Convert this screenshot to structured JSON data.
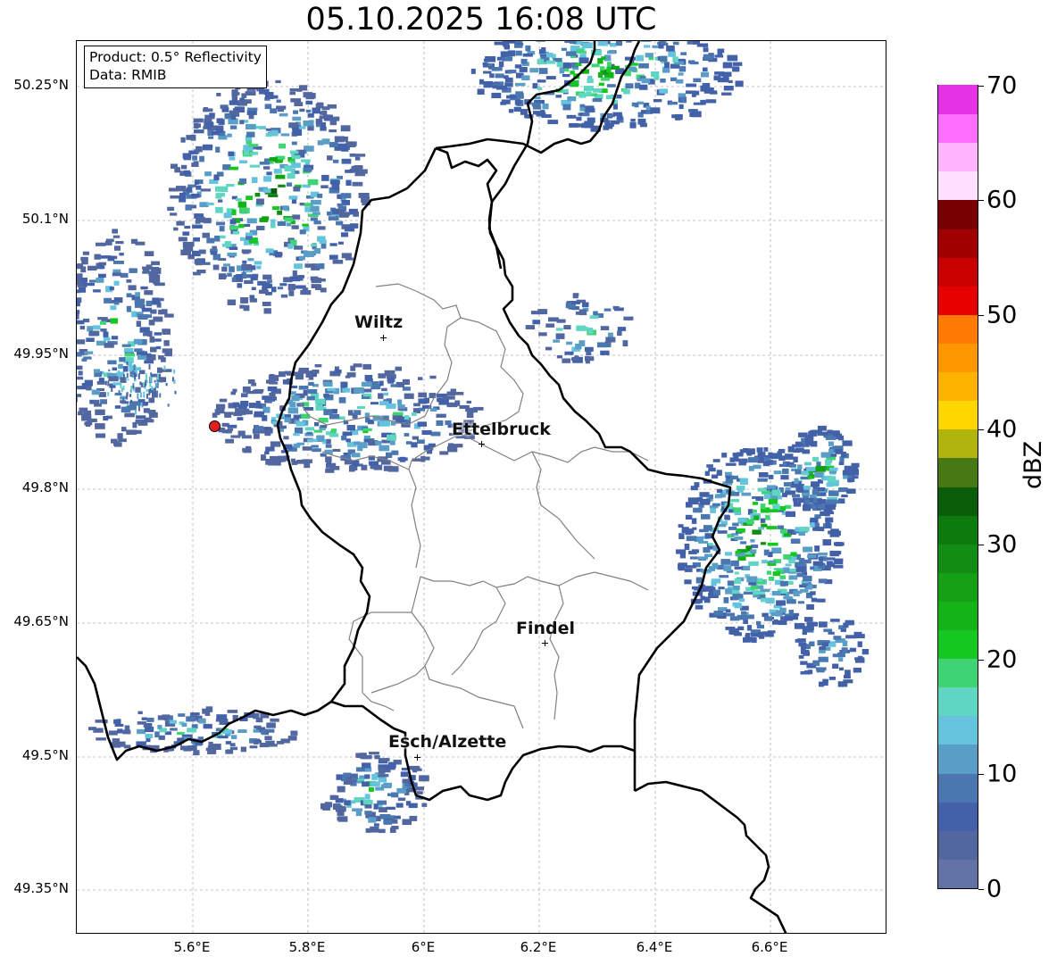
{
  "title": "05.10.2025 16:08 UTC",
  "info_box": {
    "product": "Product: 0.5° Reflectivity",
    "data": "Data: RMIB"
  },
  "axes": {
    "lat_labels": [
      "50.25°N",
      "50.1°N",
      "49.95°N",
      "49.8°N",
      "49.65°N",
      "49.5°N",
      "49.35°N"
    ],
    "lon_labels": [
      "5.6°E",
      "5.8°E",
      "6°E",
      "6.2°E",
      "6.4°E",
      "6.6°E"
    ]
  },
  "cities": [
    {
      "name": "Wiltz"
    },
    {
      "name": "Ettelbruck"
    },
    {
      "name": "Findel"
    },
    {
      "name": "Esch/Alzette"
    }
  ],
  "colorbar": {
    "unit": "dBZ",
    "tick_labels": [
      "0",
      "10",
      "20",
      "30",
      "40",
      "50",
      "60",
      "70"
    ],
    "colors": [
      "#6272a4",
      "#5266a0",
      "#4361a8",
      "#4a77b0",
      "#5a9ec8",
      "#66c3dd",
      "#5fd6c2",
      "#3fd473",
      "#15c81f",
      "#14b419",
      "#14a214",
      "#128c12",
      "#0d7a0d",
      "#0a5e0a",
      "#467813",
      "#b0b40c",
      "#ffd700",
      "#ffb300",
      "#ff9800",
      "#ff7a00",
      "#e60000",
      "#c80000",
      "#a00000",
      "#780000",
      "#ffe0ff",
      "#ffb4ff",
      "#ff6eff",
      "#e632e6"
    ]
  },
  "colors": {
    "border_line": "#000000",
    "canton_line": "#808080",
    "grid": "#b0b0b0",
    "radar_site": "#e02020"
  }
}
